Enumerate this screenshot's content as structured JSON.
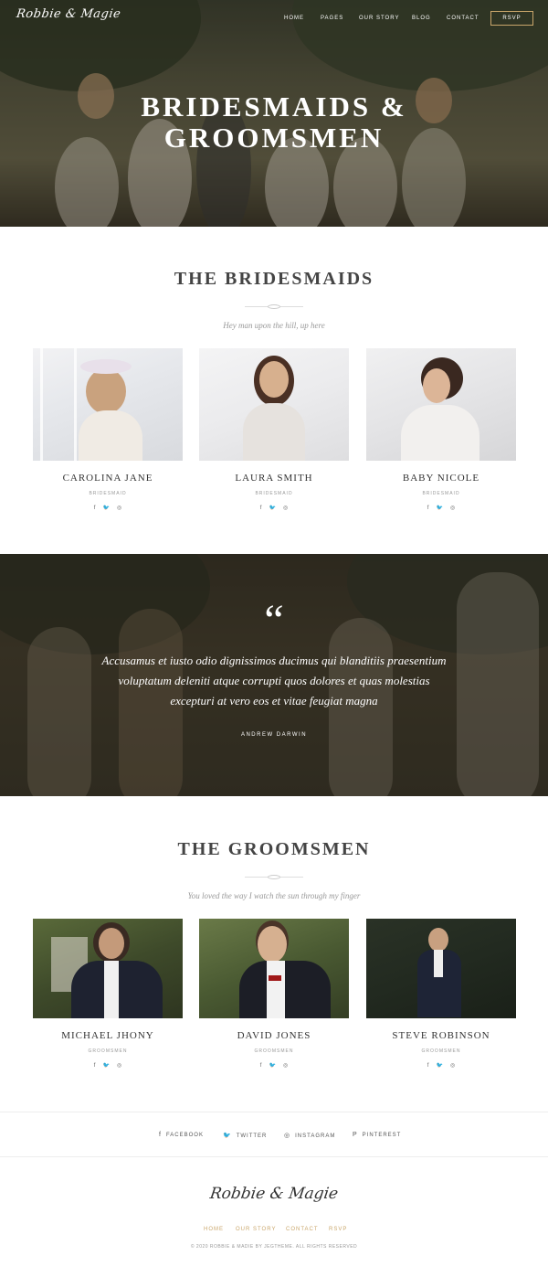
{
  "header": {
    "logo": "Robbie & Magie",
    "nav": [
      "HOME",
      "PAGES",
      "OUR STORY",
      "BLOG",
      "CONTACT"
    ],
    "rsvp_label": "RSVP",
    "hero_title_line1": "BRIDESMAIDS &",
    "hero_title_line2": "GROOMSMEN"
  },
  "bridesmaids": {
    "title": "THE BRIDESMAIDS",
    "subtitle": "Hey man upon the hill, up here",
    "people": [
      {
        "name": "CAROLINA JANE",
        "role": "BRIDESMAID"
      },
      {
        "name": "LAURA SMITH",
        "role": "BRIDESMAID"
      },
      {
        "name": "BABY NICOLE",
        "role": "BRIDESMAID"
      }
    ]
  },
  "quote": {
    "mark": "“",
    "text": "Accusamus et iusto odio dignissimos ducimus qui blanditiis praesentium voluptatum deleniti atque corrupti quos dolores et quas molestias excepturi at vero eos et vitae feugiat magna",
    "author": "ANDREW DARWIN"
  },
  "groomsmen": {
    "title": "THE GROOMSMEN",
    "subtitle": "You loved the way I watch the sun through my finger",
    "people": [
      {
        "name": "MICHAEL JHONY",
        "role": "GROOMSMEN"
      },
      {
        "name": "DAVID JONES",
        "role": "GROOMSMEN"
      },
      {
        "name": "STEVE ROBINSON",
        "role": "GROOMSMEN"
      }
    ]
  },
  "social_bar": {
    "facebook": "FACEBOOK",
    "twitter": "TWITTER",
    "instagram": "INSTAGRAM",
    "pinterest": "PINTEREST"
  },
  "footer": {
    "logo": "Robbie & Magie",
    "nav": [
      "HOME",
      "OUR STORY",
      "CONTACT",
      "RSVP"
    ],
    "copyright": "© 2020 ROBBIE & MADIE BY JEGTHEME. ALL RIGHTS RESERVED"
  },
  "icons": {
    "facebook": "facebook-icon",
    "twitter": "twitter-icon",
    "instagram": "instagram-icon",
    "pinterest": "pinterest-icon"
  },
  "colors": {
    "accent": "#c9a66b",
    "text": "#444444",
    "muted": "#999999"
  }
}
